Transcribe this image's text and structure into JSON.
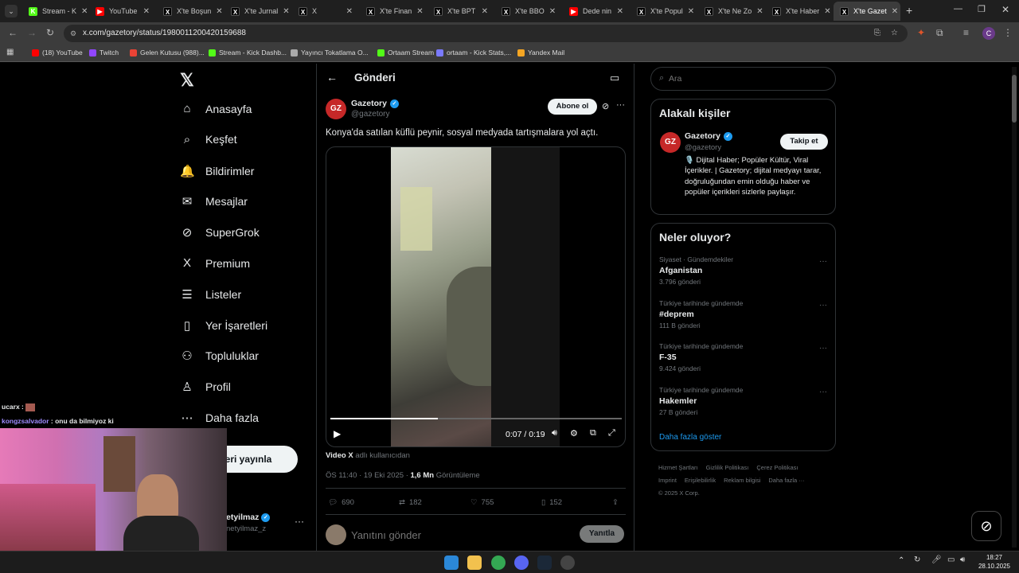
{
  "browser": {
    "tabs": [
      {
        "label": "Stream - K",
        "fav": "K",
        "color": "#53fc18"
      },
      {
        "label": "YouTube",
        "fav": "▶",
        "color": "#ff0000"
      },
      {
        "label": "X'te Boşun",
        "fav": "X",
        "color": "#000"
      },
      {
        "label": "X'te Jurnal",
        "fav": "X",
        "color": "#000"
      },
      {
        "label": "X",
        "fav": "X",
        "color": "#000"
      },
      {
        "label": "X'te Finan",
        "fav": "X",
        "color": "#000"
      },
      {
        "label": "X'te BPT",
        "fav": "X",
        "color": "#000"
      },
      {
        "label": "X'te BBO",
        "fav": "X",
        "color": "#000"
      },
      {
        "label": "Dede nin",
        "fav": "▶",
        "color": "#ff0000"
      },
      {
        "label": "X'te Popul",
        "fav": "X",
        "color": "#000"
      },
      {
        "label": "X'te Ne Zo",
        "fav": "X",
        "color": "#000"
      },
      {
        "label": "X'te Haber",
        "fav": "X",
        "color": "#000"
      },
      {
        "label": "X'te Gazet",
        "fav": "X",
        "color": "#000"
      }
    ],
    "url": "x.com/gazetory/status/1980011200420159688",
    "profile_initial": "C",
    "bookmarks": [
      {
        "label": "(18) YouTube",
        "color": "#ff0000"
      },
      {
        "label": "Twitch",
        "color": "#9146ff"
      },
      {
        "label": "Gelen Kutusu (988)...",
        "color": "#ea4335"
      },
      {
        "label": "Stream - Kick Dashb...",
        "color": "#53fc18"
      },
      {
        "label": "Yayıncı Tokatlama O...",
        "color": "#aaaaaa"
      },
      {
        "label": "Ortaam Stream",
        "color": "#53fc18"
      },
      {
        "label": "ortaam - Kick Stats,...",
        "color": "#7a7aff"
      },
      {
        "label": "Yandex Mail",
        "color": "#f5a623"
      }
    ]
  },
  "sidebar": {
    "items": [
      {
        "label": "Anasayfa",
        "icon": "⌂"
      },
      {
        "label": "Keşfet",
        "icon": "⌕"
      },
      {
        "label": "Bildirimler",
        "icon": "🔔"
      },
      {
        "label": "Mesajlar",
        "icon": "✉"
      },
      {
        "label": "SuperGrok",
        "icon": "⊘"
      },
      {
        "label": "Premium",
        "icon": "X"
      },
      {
        "label": "Listeler",
        "icon": "☰"
      },
      {
        "label": "Yer İşaretleri",
        "icon": "▯"
      },
      {
        "label": "Topluluklar",
        "icon": "⚇"
      },
      {
        "label": "Profil",
        "icon": "♙"
      },
      {
        "label": "Daha fazla",
        "icon": "⋯"
      }
    ],
    "post_button": "eri yayınla",
    "account_name": "etyilmaz",
    "account_handle": "netyilmaz_z"
  },
  "stream_overlay": {
    "chat": [
      {
        "user": "ucarx",
        "message": ""
      },
      {
        "user": "kongzsalvador",
        "message": "onu da bilmiyoz ki"
      }
    ]
  },
  "post": {
    "header_title": "Gönderi",
    "author_name": "Gazetory",
    "author_handle": "@gazetory",
    "subscribe_label": "Abone ol",
    "text": "Konya'da satılan küflü peynir, sosyal medyada tartışmalara yol açtı.",
    "video_time": "0:07 / 0:19",
    "video_progress": 0.37,
    "video_source_brand": "Video X",
    "video_source_suffix": "adlı kullanıcıdan",
    "timestamp": "ÖS 11:40 · 19 Eki 2025 · ",
    "views_count": "1,6 Mn",
    "views_label": "Görüntüleme",
    "replies": "690",
    "reposts": "182",
    "likes": "755",
    "bookmarks": "152",
    "reply_placeholder": "Yanıtını gönder",
    "reply_button": "Yanıtla"
  },
  "right": {
    "search_placeholder": "Ara",
    "related_title": "Alakalı kişiler",
    "related_name": "Gazetory",
    "related_handle": "@gazetory",
    "follow_label": "Takip et",
    "related_bio": "🎙️ Dijital Haber; Popüler Kültür, Viral İçerikler. | Gazetory; dijital medyayı tarar, doğruluğundan emin olduğu haber ve popüler içerikleri sizlerle paylaşır.",
    "trends_title": "Neler oluyor?",
    "trends": [
      {
        "category": "Siyaset · Gündemdekiler",
        "name": "Afganistan",
        "count": "3.796 gönderi"
      },
      {
        "category": "Türkiye tarihinde gündemde",
        "name": "#deprem",
        "count": "111 B gönderi"
      },
      {
        "category": "Türkiye tarihinde gündemde",
        "name": "F-35",
        "count": "9.424 gönderi"
      },
      {
        "category": "Türkiye tarihinde gündemde",
        "name": "Hakemler",
        "count": "27 B gönderi"
      }
    ],
    "show_more": "Daha fazla göster",
    "footer_links": [
      "Hizmet Şartları",
      "Gizlilik Politikası",
      "Çerez Politikası",
      "Imprint",
      "Erişilebilirlik",
      "Reklam bilgisi",
      "Daha fazla ···"
    ],
    "copyright": "© 2025 X Corp."
  },
  "taskbar": {
    "time": "18:27",
    "date": "28.10.2025"
  }
}
